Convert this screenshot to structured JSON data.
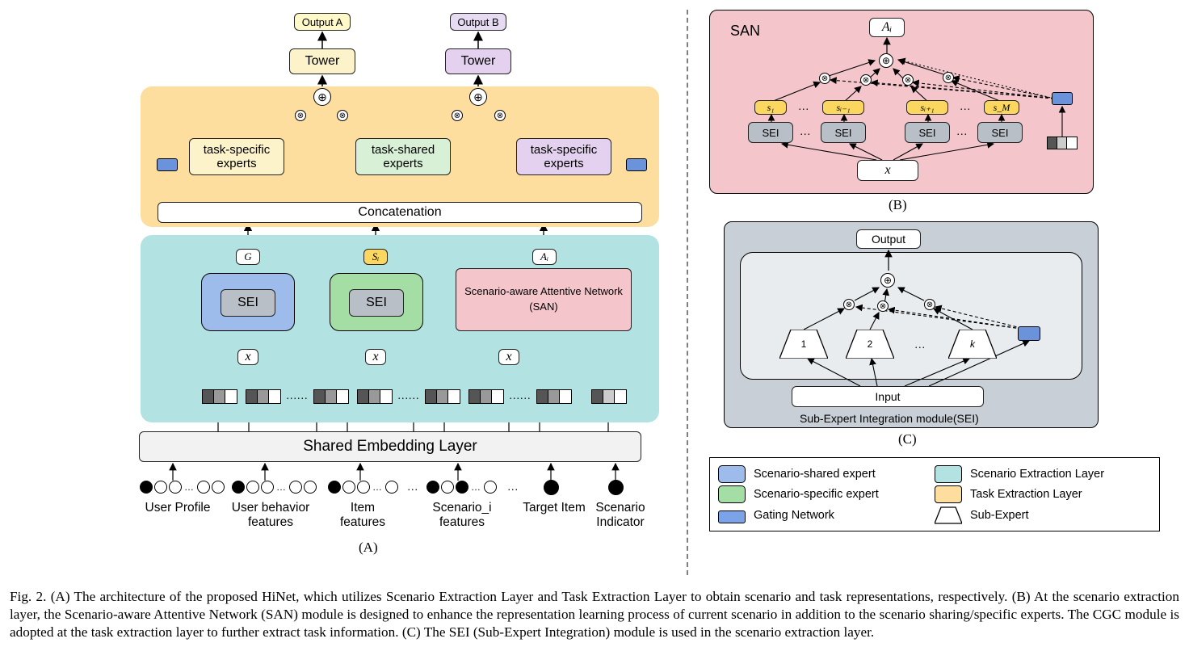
{
  "panelA": {
    "output_a": "Output A",
    "output_b": "Output B",
    "tower_a": "Tower",
    "tower_b": "Tower",
    "task_specific_a": "task-specific\nexperts",
    "task_shared": "task-shared\nexperts",
    "task_specific_b": "task-specific\nexperts",
    "concat": "Concatenation",
    "g": "G",
    "s_i": "Sᵢ",
    "a_i": "Aᵢ",
    "sei_a": "SEI",
    "sei_b": "SEI",
    "san_title": "Scenario-aware Attentive Network",
    "san_sub": "(SAN)",
    "x1": "x",
    "x2": "x",
    "x3": "x",
    "shared_embedding": "Shared Embedding Layer",
    "features": {
      "user_profile": "User Profile",
      "user_behavior": "User behavior\nfeatures",
      "item_features": "Item\nfeatures",
      "scenario_i": "Scenario_i\nfeatures",
      "target_item": "Target Item",
      "scenario_ind": "Scenario\nIndicator",
      "ellipsis": "…"
    },
    "letter": "(A)"
  },
  "panelB": {
    "title": "SAN",
    "a_i": "Aᵢ",
    "s": [
      "s₁",
      "sᵢ₋₁",
      "sᵢ₊₁",
      "s_M"
    ],
    "sei": "SEI",
    "x": "x",
    "letter": "(B)"
  },
  "panelC": {
    "output": "Output",
    "nums": [
      "1",
      "2",
      "k"
    ],
    "input": "Input",
    "title": "Sub-Expert Integration module(SEI)",
    "letter": "(C)"
  },
  "legend": {
    "shared_expert": "Scenario-shared expert",
    "specific_expert": "Scenario-specific expert",
    "gating": "Gating Network",
    "sel": "Scenario Extraction Layer",
    "tel": "Task Extraction Layer",
    "subexpert": "Sub-Expert"
  },
  "caption": "Fig. 2.    (A) The architecture of the proposed HiNet, which utilizes Scenario Extraction Layer and Task Extraction Layer to obtain scenario and task representations, respectively. (B) At the scenario extraction layer, the Scenario-aware Attentive Network (SAN) module is designed to enhance the representation learning process of current scenario in addition to the scenario sharing/specific experts. The CGC module is adopted at the task extraction layer to further extract task information. (C) The SEI (Sub-Expert Integration) module is used in the scenario extraction layer."
}
